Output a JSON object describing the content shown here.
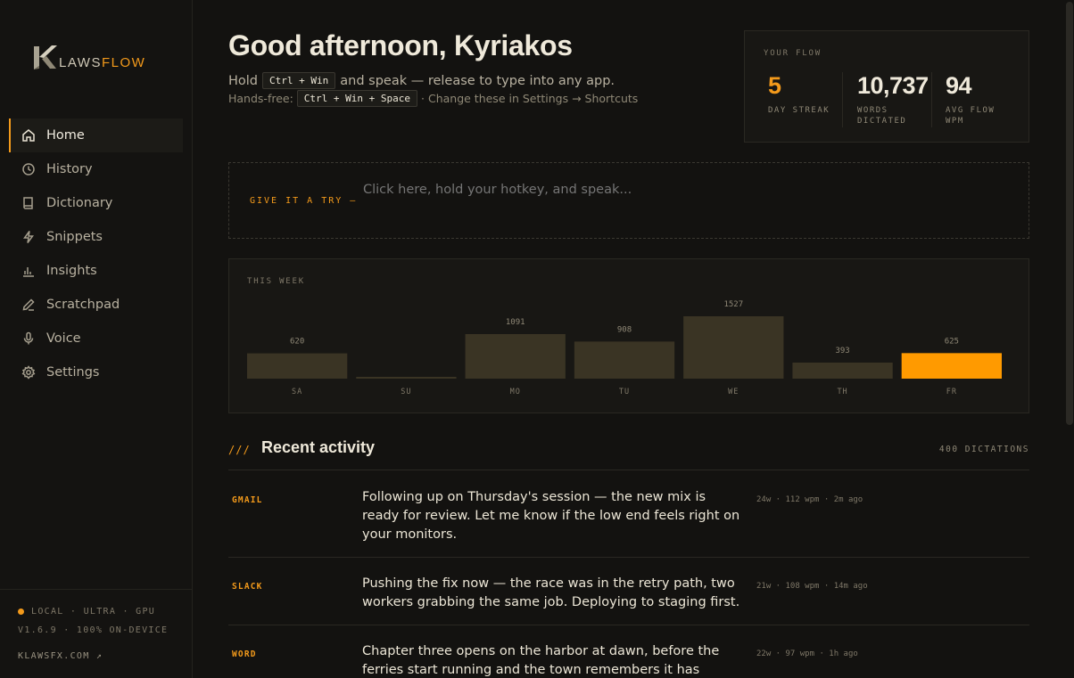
{
  "app": {
    "logo_text_main": "LAWS",
    "logo_text_accent": "FLOW"
  },
  "sidebar": {
    "items": [
      {
        "label": "Home",
        "icon": "home-icon",
        "active": true
      },
      {
        "label": "History",
        "icon": "clock-icon",
        "active": false
      },
      {
        "label": "Dictionary",
        "icon": "book-icon",
        "active": false
      },
      {
        "label": "Snippets",
        "icon": "lightning-icon",
        "active": false
      },
      {
        "label": "Insights",
        "icon": "bar-chart-icon",
        "active": false
      },
      {
        "label": "Scratchpad",
        "icon": "pencil-icon",
        "active": false
      },
      {
        "label": "Voice",
        "icon": "microphone-icon",
        "active": false
      },
      {
        "label": "Settings",
        "icon": "gear-icon",
        "active": false
      }
    ],
    "footer": {
      "status": "LOCAL · ULTRA · GPU",
      "version": "V1.6.9 · 100% ON-DEVICE",
      "link": "KLAWSFX.COM ↗"
    }
  },
  "header": {
    "greeting": "Good afternoon, Kyriakos",
    "hold_prefix": "Hold",
    "hold_keys": "Ctrl + Win",
    "hold_suffix": "and speak — release to type into any app.",
    "hands_prefix": "Hands-free:",
    "hands_keys": "Ctrl + Win + Space",
    "hands_suffix": "· Change these in Settings → Shortcuts"
  },
  "stats": {
    "label": "YOUR FLOW",
    "streak_value": "5",
    "streak_label": "DAY STREAK",
    "words_value": "10,737",
    "words_label_1": "WORDS",
    "words_label_2": "DICTATED",
    "wpm_value": "94",
    "wpm_label_1": "AVG FLOW",
    "wpm_label_2": "WPM"
  },
  "try": {
    "label": "GIVE IT A TRY —",
    "placeholder": "Click here, hold your hotkey, and speak..."
  },
  "week": {
    "label": "THIS WEEK"
  },
  "chart_data": {
    "type": "bar",
    "categories": [
      "SA",
      "SU",
      "MO",
      "TU",
      "WE",
      "TH",
      "FR"
    ],
    "values": [
      620,
      0,
      1091,
      908,
      1527,
      393,
      625
    ],
    "value_labels": [
      "620",
      "",
      "1091",
      "908",
      "1527",
      "393",
      "625"
    ],
    "highlight_index": 6,
    "bar_color": "#3a3424",
    "highlight_color": "#ff9a00"
  },
  "recent": {
    "title": "Recent activity",
    "count": "400 DICTATIONS",
    "items": [
      {
        "app": "GMAIL",
        "text": "Following up on Thursday's session — the new mix is ready for review. Let me know if the low end feels right on your monitors.",
        "meta": "24w · 112 wpm · 2m ago"
      },
      {
        "app": "SLACK",
        "text": "Pushing the fix now — the race was in the retry path, two workers grabbing the same job. Deploying to staging first.",
        "meta": "21w · 108 wpm · 14m ago"
      },
      {
        "app": "WORD",
        "text": "Chapter three opens on the harbor at dawn, before the ferries start running and the town remembers it has somewhere to be.",
        "meta": "22w · 97 wpm · 1h ago"
      }
    ]
  },
  "colors": {
    "accent": "#f39a1b",
    "background": "#131210",
    "panel": "#181714"
  }
}
